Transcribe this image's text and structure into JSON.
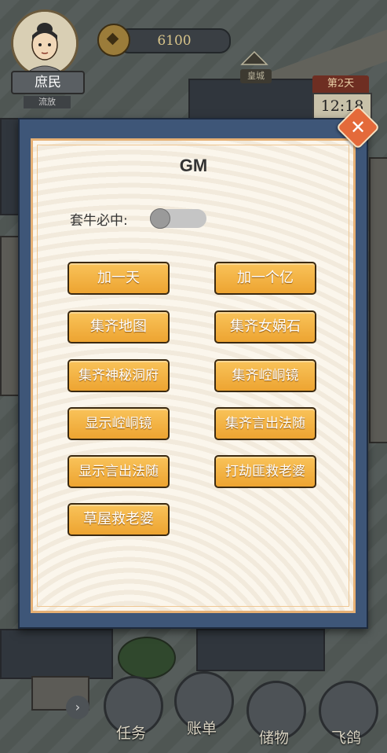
{
  "hud": {
    "rank": "庶民",
    "rank_sub": "流放",
    "coins": "6100",
    "palace_label": "皇城",
    "day": "第2天",
    "time": "12:18"
  },
  "dialog": {
    "title": "GM",
    "toggle_label": "套牛必中:",
    "toggle_on": false,
    "buttons": [
      "加一天",
      "加一个亿",
      "集齐地图",
      "集齐女娲石",
      "集齐神秘洞府",
      "集齐崆峒镜",
      "显示崆峒镜",
      "集齐言出法随",
      "显示言出法随",
      "打劫匪救老婆",
      "草屋救老婆"
    ],
    "close_icon": "close-icon",
    "colors": {
      "button": "#f2b13f",
      "frame": "#3e5678",
      "close": "#e46a3a"
    }
  },
  "nav": {
    "items": [
      "任务",
      "账单",
      "储物",
      "飞鸽"
    ]
  }
}
